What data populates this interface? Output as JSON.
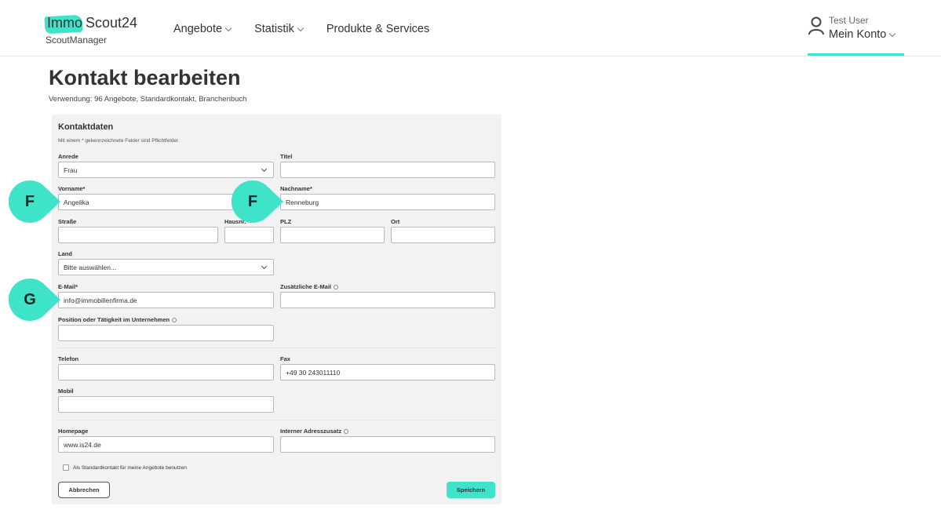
{
  "header": {
    "logo_immo": "Immo",
    "logo_scout": "Scout24",
    "logo_sub": "ScoutManager",
    "nav": [
      "Angebote",
      "Statistik",
      "Produkte & Services"
    ],
    "user_name": "Test User",
    "account_label": "Mein Konto",
    "accent_color": "#3fe3c9"
  },
  "page": {
    "title": "Kontakt bearbeiten",
    "usage": "Verwendung: 96 Angebote, Standardkontakt, Branchenbuch"
  },
  "form": {
    "section_title": "Kontaktdaten",
    "hint": "Mit einem * gekennzeichnete Felder sind Pflichtfelder.",
    "anrede": {
      "label": "Anrede",
      "value": "Frau"
    },
    "titel": {
      "label": "Titel",
      "value": ""
    },
    "vorname": {
      "label": "Vorname*",
      "value": "Angelika"
    },
    "nachname": {
      "label": "Nachname*",
      "value": "Renneburg"
    },
    "strasse": {
      "label": "Straße",
      "value": ""
    },
    "hausnr": {
      "label": "Hausnr.",
      "value": ""
    },
    "plz": {
      "label": "PLZ",
      "value": ""
    },
    "ort": {
      "label": "Ort",
      "value": ""
    },
    "land": {
      "label": "Land",
      "value": "Bitte auswählen..."
    },
    "email": {
      "label": "E-Mail*",
      "value": "info@immobilienfirma.de"
    },
    "zusatz_email": {
      "label": "Zusätzliche E-Mail",
      "value": ""
    },
    "position": {
      "label": "Position oder Tätigkeit im Unternehmen",
      "value": ""
    },
    "telefon": {
      "label": "Telefon",
      "value": ""
    },
    "fax": {
      "label": "Fax",
      "value": "+49 30 243011110"
    },
    "mobil": {
      "label": "Mobil",
      "value": ""
    },
    "homepage": {
      "label": "Homepage",
      "value": "www.is24.de"
    },
    "adresszusatz": {
      "label": "Interner Adresszusatz",
      "value": ""
    },
    "standard_checkbox": {
      "label": "Als Standardkontakt für meine Angebote benutzen",
      "checked": false
    },
    "cancel_label": "Abbrechen",
    "save_label": "Speichern"
  },
  "markers": [
    {
      "letter": "F",
      "icon": "callout-marker-icon",
      "target": "vorname"
    },
    {
      "letter": "F",
      "icon": "callout-marker-icon",
      "target": "nachname"
    },
    {
      "letter": "G",
      "icon": "callout-marker-icon",
      "target": "email"
    }
  ]
}
